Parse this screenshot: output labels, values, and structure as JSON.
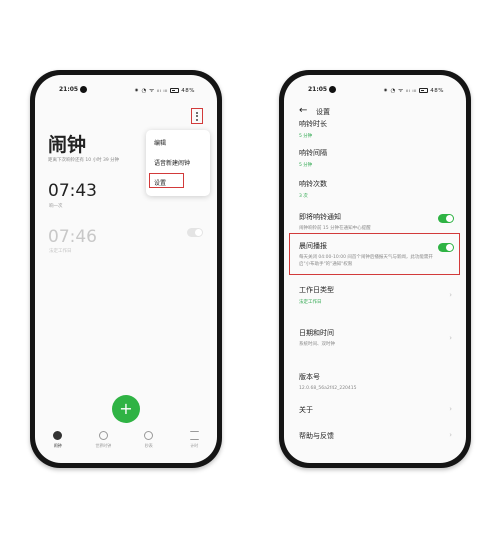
{
  "left_phone": {
    "status": {
      "time": "21:05",
      "icons": "✷ ◔ ᯤ ᵢₗₗ ᵢₗₗ",
      "battery": "48%"
    },
    "title": "闹钟",
    "next_alarm_text": "距离下次响铃还有 10 小时 39 分钟",
    "alarms": [
      {
        "time": "07:43",
        "repeat": "响一次",
        "enabled": true
      },
      {
        "time": "07:46",
        "repeat": "法定工作日",
        "enabled": false
      }
    ],
    "menu": {
      "items": [
        "编辑",
        "语音新建闹钟",
        "设置"
      ],
      "highlighted": "设置"
    },
    "fab_label": "+",
    "tabs": [
      {
        "label": "闹钟",
        "icon": "alarm-icon",
        "active": true
      },
      {
        "label": "世界时钟",
        "icon": "world-clock-icon",
        "active": false
      },
      {
        "label": "秒表",
        "icon": "stopwatch-icon",
        "active": false
      },
      {
        "label": "计时",
        "icon": "timer-icon",
        "active": false
      }
    ]
  },
  "right_phone": {
    "status": {
      "time": "21:05",
      "icons": "✷ ◔ ᯤ ᵢₗₗ ᵢₗₗ",
      "battery": "48%"
    },
    "header": {
      "back": "←",
      "title": "设置"
    },
    "rows": [
      {
        "title": "响铃时长",
        "sub": "5 分钟"
      },
      {
        "title": "响铃间隔",
        "sub": "5 分钟"
      },
      {
        "title": "响铃次数",
        "sub": "3 次"
      },
      {
        "title": "即将响铃通知",
        "desc": "闹钟响铃前 15 分钟在通知中心提醒",
        "toggle": true
      },
      {
        "title": "晨间播报",
        "desc": "每天关闭 04:00-10:00 间首个闹钟后播报天气与新闻，此功能需开启\"小布助手\"的\"通知\"权限",
        "toggle": true
      },
      {
        "title": "工作日类型",
        "sub": "法定工作日"
      },
      {
        "title": "日期和时间",
        "desc": "系统时间、双时钟"
      },
      {
        "title": "版本号",
        "desc": "12.0.68_56a2f42_220415"
      },
      {
        "title": "关于"
      },
      {
        "title": "帮助与反馈"
      }
    ]
  },
  "colors": {
    "accent_green": "#2fb344",
    "highlight_red": "#d23a3a"
  }
}
